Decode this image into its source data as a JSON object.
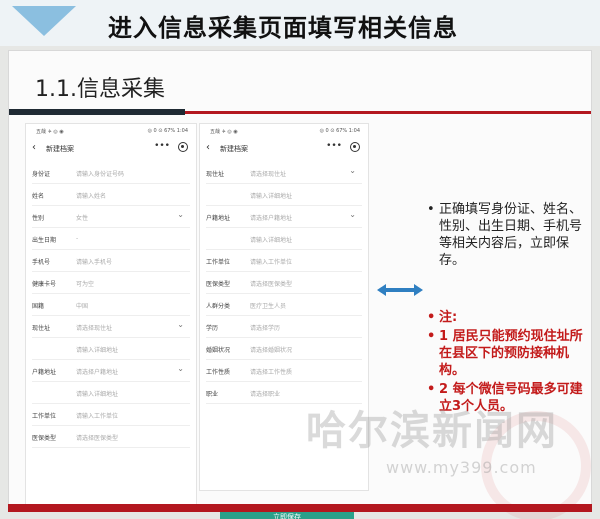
{
  "banner": {
    "title": "进入信息采集页面填写相关信息"
  },
  "slide": {
    "section_title": "1.1.信息采集"
  },
  "phone_left": {
    "status_left": "五哉 ✈ ◎ ◉",
    "status_right": "◎ 0 ⊙ 67% 1:04",
    "title": "新建档案",
    "rows": [
      {
        "label": "身份证",
        "value": "请输入身份证号码",
        "chev": ""
      },
      {
        "label": "姓名",
        "value": "请输入姓名",
        "chev": ""
      },
      {
        "label": "性别",
        "value": "女性",
        "chev": "⌄"
      },
      {
        "label": "出生日期",
        "value": "-",
        "chev": ""
      },
      {
        "label": "手机号",
        "value": "请输入手机号",
        "chev": ""
      },
      {
        "label": "健康卡号",
        "value": "可为空",
        "chev": ""
      },
      {
        "label": "国籍",
        "value": "中国",
        "chev": ""
      },
      {
        "label": "现住址",
        "value": "请选择现住址",
        "chev": "⌄"
      },
      {
        "label": "",
        "value": "请输入详细地址",
        "chev": ""
      },
      {
        "label": "户籍地址",
        "value": "请选择户籍地址",
        "chev": "⌄"
      },
      {
        "label": "",
        "value": "请输入详细地址",
        "chev": ""
      },
      {
        "label": "工作单位",
        "value": "请输入工作单位",
        "chev": ""
      },
      {
        "label": "医保类型",
        "value": "请选择医保类型",
        "chev": ""
      }
    ]
  },
  "phone_right": {
    "status_left": "五哉 ✈ ◎ ◉",
    "status_right": "◎ 0 ⊙ 67% 1:04",
    "title": "新建档案",
    "rows": [
      {
        "label": "现住址",
        "value": "请选择现住址",
        "chev": "⌄"
      },
      {
        "label": "",
        "value": "请输入详细地址",
        "chev": ""
      },
      {
        "label": "户籍地址",
        "value": "请选择户籍地址",
        "chev": "⌄"
      },
      {
        "label": "",
        "value": "请输入详细地址",
        "chev": ""
      },
      {
        "label": "工作单位",
        "value": "请输入工作单位",
        "chev": ""
      },
      {
        "label": "医保类型",
        "value": "请选择医保类型",
        "chev": ""
      },
      {
        "label": "人群分类",
        "value": "医疗卫生人员",
        "chev": ""
      },
      {
        "label": "学历",
        "value": "请选择学历",
        "chev": ""
      },
      {
        "label": "婚姻状况",
        "value": "请选择婚姻状况",
        "chev": ""
      },
      {
        "label": "工作性质",
        "value": "请选择工作性质",
        "chev": ""
      },
      {
        "label": "职业",
        "value": "请选择职业",
        "chev": ""
      }
    ],
    "save_label": "立即保存"
  },
  "notes": {
    "bullet": "•",
    "instruction": "正确填写身份证、姓名、性别、出生日期、手机号等相关内容后，立即保存。",
    "note_title": "注:",
    "note_1": "1 居民只能预约现住址所在县区下的预防接种机构。",
    "note_2": "2 每个微信号码最多可建立3个人员。"
  },
  "watermark": {
    "name": "哈尔滨新闻网",
    "url": "www.my399.com"
  },
  "colors": {
    "accent_red": "#b3171f",
    "teal_button": "#2aa08a",
    "arrow_blue": "#2f7fc1"
  }
}
